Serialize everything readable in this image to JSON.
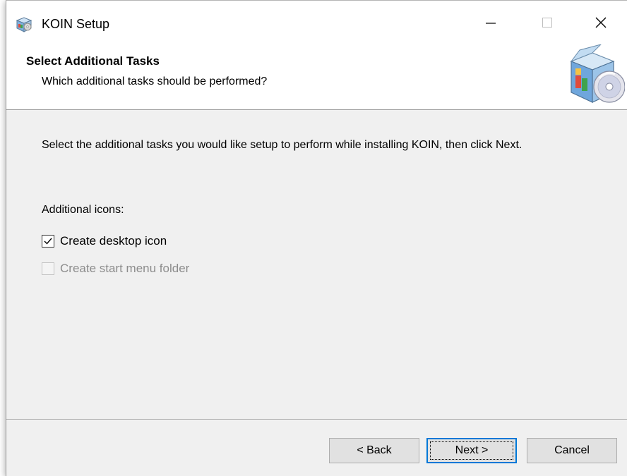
{
  "window": {
    "title": "KOIN Setup",
    "icon": "setup-box-icon"
  },
  "titlebar_controls": {
    "minimize_icon": "minimize-icon",
    "maximize_icon": "maximize-icon",
    "close_icon": "close-icon"
  },
  "header": {
    "title": "Select Additional Tasks",
    "subtitle": "Which additional tasks should be performed?",
    "image": "installer-box-cd-icon"
  },
  "content": {
    "instructions": "Select the additional tasks you would like setup to perform while installing KOIN, then click Next.",
    "section_label": "Additional icons:",
    "tasks": [
      {
        "label": "Create desktop icon",
        "checked": true,
        "enabled": true
      },
      {
        "label": "Create start menu folder",
        "checked": false,
        "enabled": false
      }
    ]
  },
  "buttons": {
    "back": "< Back",
    "next": "Next >",
    "cancel": "Cancel"
  },
  "colors": {
    "focus_blue": "#0078d7",
    "dialog_bg": "#f0f0f0",
    "disabled_text": "#8c8c8c"
  }
}
